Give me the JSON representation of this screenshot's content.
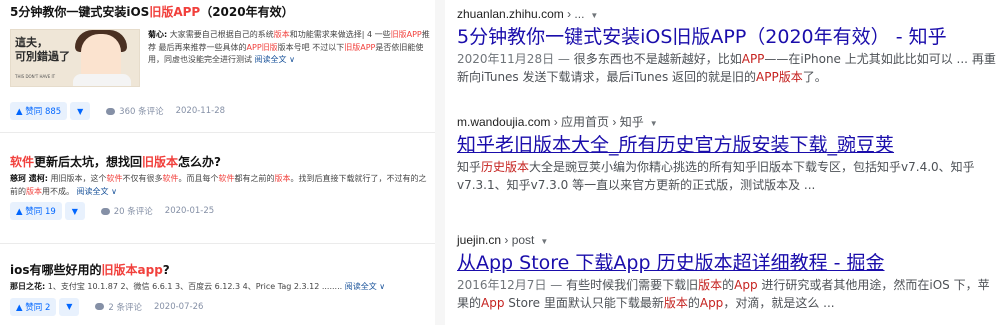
{
  "zhihu": {
    "items": [
      {
        "title_before": "5分钟教你一键式安装iOS",
        "title_hl": "旧版APP",
        "title_after": "（2020年有效）",
        "thumb_line1": "這夫，",
        "thumb_line2": "可別錯過了",
        "thumb_small": "THIS DON'T HAVE IT",
        "author": "菊心:",
        "body": [
          {
            "t": " 大家需要自己根据自己的系统",
            "h": false
          },
          {
            "t": "版本",
            "h": true
          },
          {
            "t": "和功能需求来做选择| 4 一些",
            "h": false
          },
          {
            "t": "旧版APP",
            "h": true
          },
          {
            "t": "推荐 最后再来推荐一些具体的",
            "h": false
          },
          {
            "t": "APP旧版",
            "h": true
          },
          {
            "t": "版本号吧 不过以下",
            "h": false
          },
          {
            "t": "旧版APP",
            "h": true
          },
          {
            "t": "是否依旧能使用，同虚也没能完全进行测试 ",
            "h": false
          }
        ],
        "read_more": "阅读全文 ∨",
        "votes": "▲ 赞同 885",
        "comments": "360 条评论",
        "date": "2020-11-28"
      },
      {
        "title_parts": [
          {
            "t": "软件",
            "h": true
          },
          {
            "t": "更新后太坑，想找回",
            "h": false
          },
          {
            "t": "旧版本",
            "h": true
          },
          {
            "t": "怎么办?",
            "h": false
          }
        ],
        "author": "慈珂 遗柯:",
        "body": [
          {
            "t": " 用旧版本，这个",
            "h": false
          },
          {
            "t": "软件",
            "h": true
          },
          {
            "t": "不仅有很多",
            "h": false
          },
          {
            "t": "软件",
            "h": true
          },
          {
            "t": "。而且每个",
            "h": false
          },
          {
            "t": "软件",
            "h": true
          },
          {
            "t": "都有之前的",
            "h": false
          },
          {
            "t": "版本",
            "h": true
          },
          {
            "t": "。找到后直接下载就行了，不过有的之前的",
            "h": false
          },
          {
            "t": "版本",
            "h": true
          },
          {
            "t": "用不成。 ",
            "h": false
          }
        ],
        "read_more": "阅读全文 ∨",
        "votes": "▲ 赞同 19",
        "comments": "20 条评论",
        "date": "2020-01-25"
      },
      {
        "title_parts": [
          {
            "t": "ios有哪些好用的",
            "h": false
          },
          {
            "t": "旧版本app",
            "h": true
          },
          {
            "t": "?",
            "h": false
          }
        ],
        "author": "那日之花:",
        "body": [
          {
            "t": " 1、支付宝 10.1.87 2、微信 6.6.1 3、百度云 6.12.3 4、Price Tag 2.3.12 ........ ",
            "h": false
          }
        ],
        "read_more": "阅读全文 ∨",
        "votes": "▲ 赞同 2",
        "comments": "2 条评论",
        "date": "2020-07-26"
      }
    ],
    "vote_down_glyph": "▼",
    "comment_icon": "comment-bubble-icon"
  },
  "results": [
    {
      "domain": "zhuanlan.zhihu.com",
      "crumbs": " › ...",
      "caret": "▼",
      "title": "5分钟教你一键式安装iOS旧版APP（2020年有效） - 知乎",
      "underline": false,
      "snippet": [
        {
          "t": "2020年11月28日 — ",
          "c": "date"
        },
        {
          "t": "很多东西也不是越新越好，比如",
          "c": ""
        },
        {
          "t": "APP",
          "c": "hl"
        },
        {
          "t": "——在iPhone 上尤其如此比如可以 ... 再重新向iTunes 发送下载请求，最后iTunes 返回的就是旧的",
          "c": ""
        },
        {
          "t": "APP版本",
          "c": "hl"
        },
        {
          "t": "了。",
          "c": ""
        }
      ]
    },
    {
      "domain": "m.wandoujia.com",
      "crumbs": " › 应用首页 › 知乎",
      "caret": "▼",
      "title": "知乎老旧版本大全_所有历史官方版安装下载_豌豆荚",
      "underline": true,
      "snippet": [
        {
          "t": "知乎",
          "c": ""
        },
        {
          "t": "历史版本",
          "c": "hl"
        },
        {
          "t": "大全是豌豆荚小编为你精心挑选的所有知乎旧版本下载专区，包括知乎v7.4.0、知乎v7.3.1、知乎v7.3.0 等一直以来官方更新的正式版，测试版本及 ...",
          "c": ""
        }
      ]
    },
    {
      "domain": "juejin.cn",
      "crumbs": " › post",
      "caret": "▼",
      "title": "从App Store 下载App 历史版本超详细教程 - 掘金",
      "underline": true,
      "snippet": [
        {
          "t": "2016年12月7日 — ",
          "c": "date"
        },
        {
          "t": "有些时候我们需要下载旧",
          "c": ""
        },
        {
          "t": "版本",
          "c": "hl"
        },
        {
          "t": "的",
          "c": ""
        },
        {
          "t": "App",
          "c": "hl"
        },
        {
          "t": " 进行研究或者其他用途，然而在iOS 下，苹果的",
          "c": ""
        },
        {
          "t": "App",
          "c": "hl"
        },
        {
          "t": " Store 里面默认只能下载最新",
          "c": ""
        },
        {
          "t": "版本",
          "c": "hl"
        },
        {
          "t": "的",
          "c": ""
        },
        {
          "t": "App",
          "c": "hl"
        },
        {
          "t": "，对滴，就是这么 ...",
          "c": ""
        }
      ]
    }
  ]
}
